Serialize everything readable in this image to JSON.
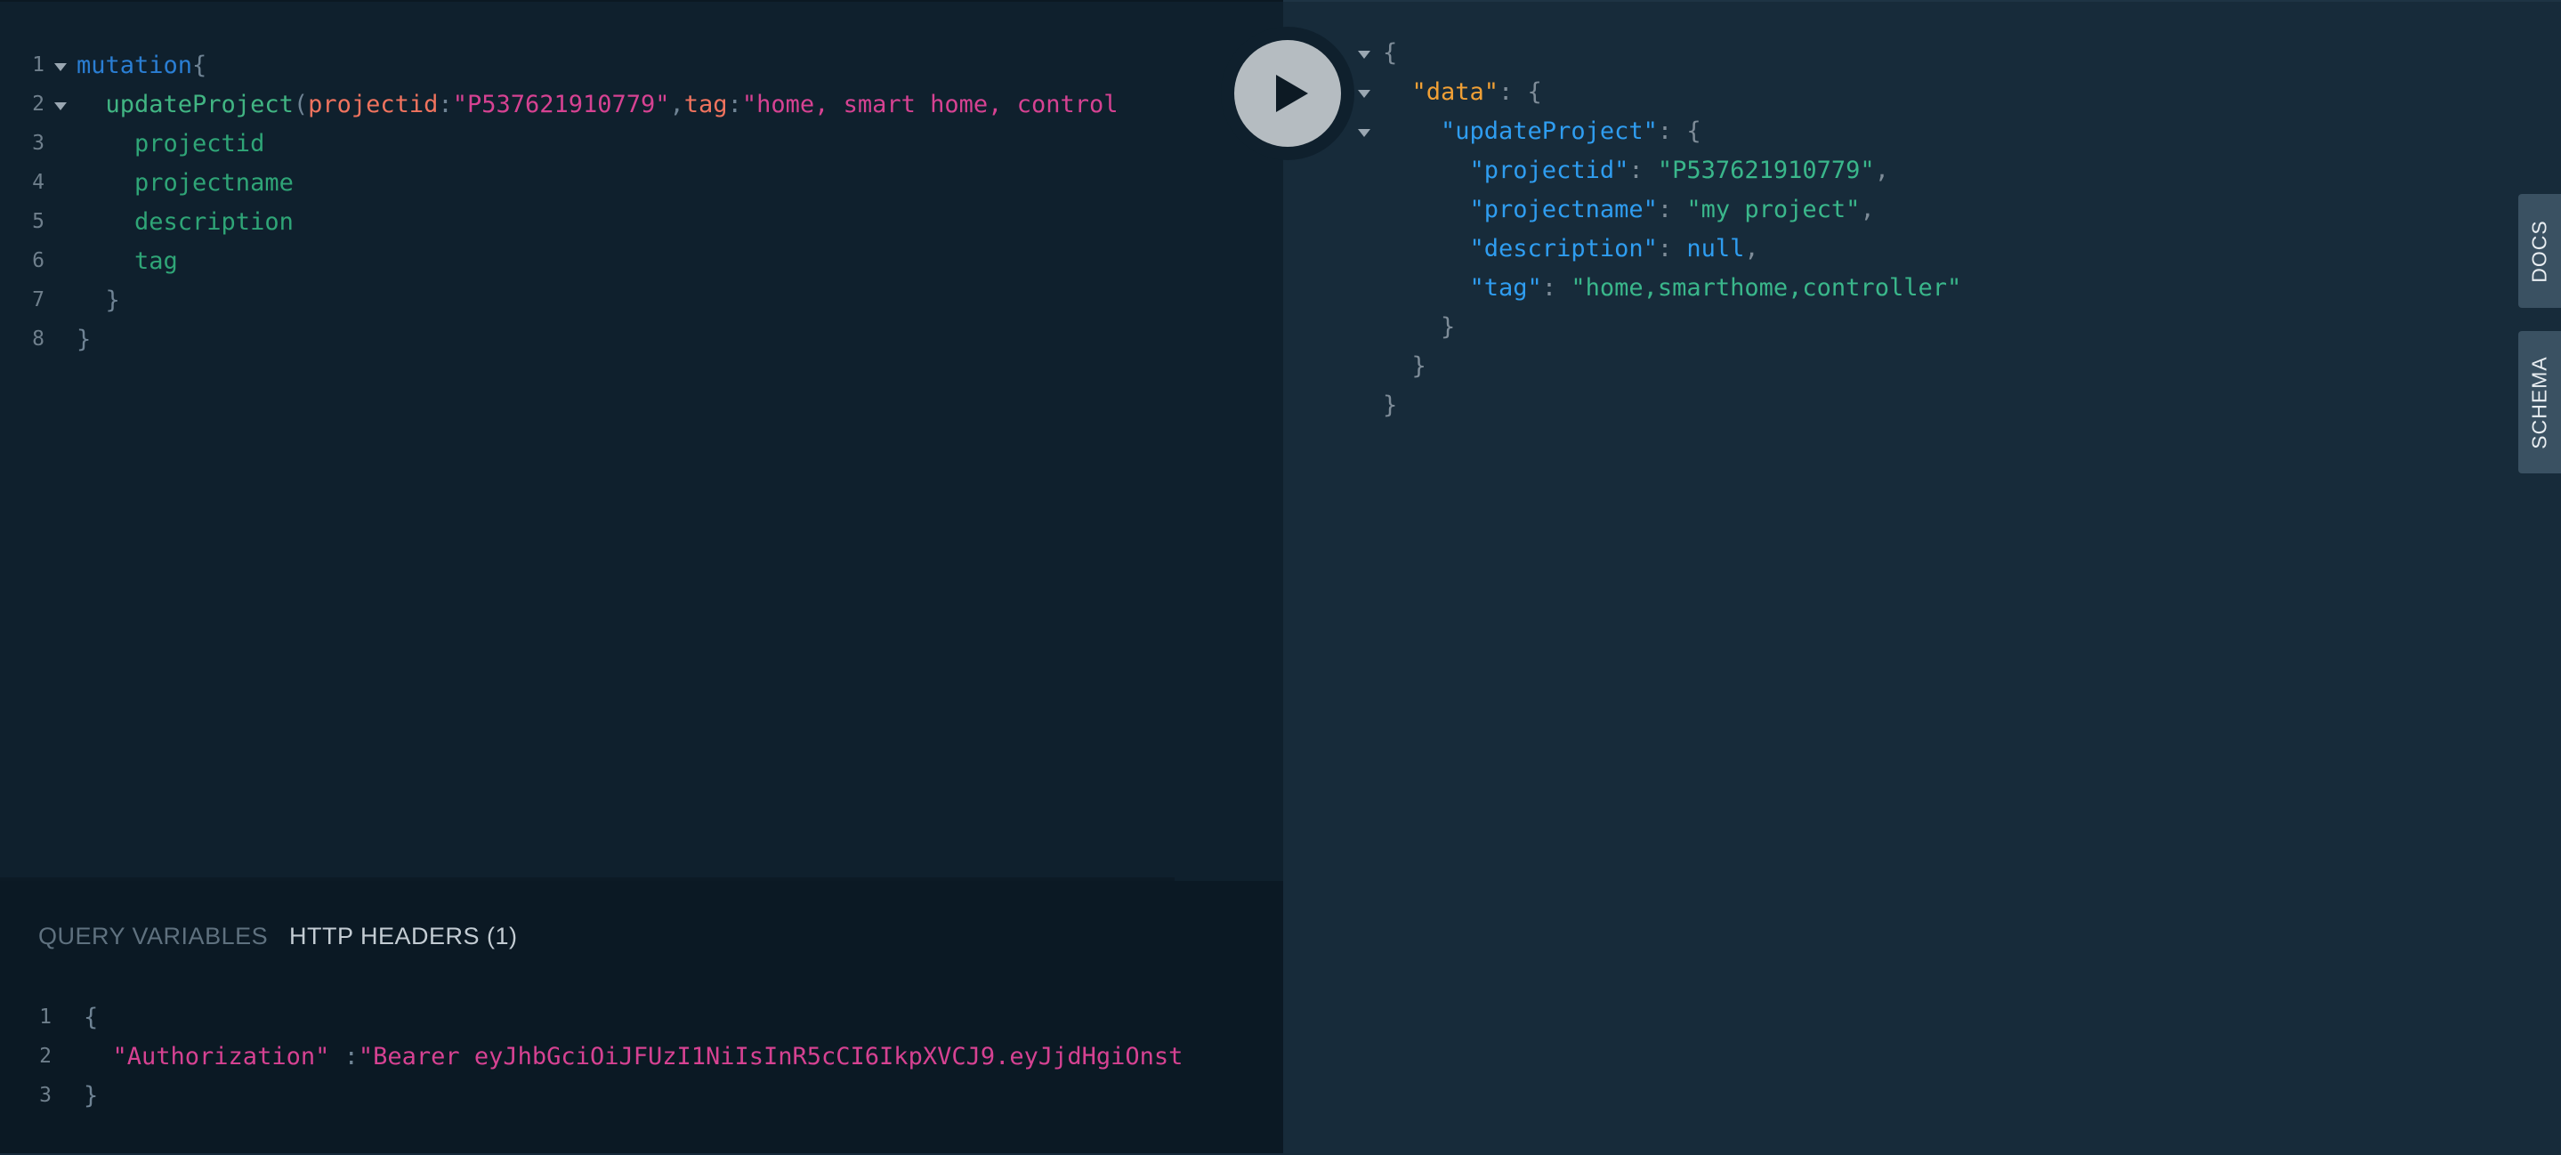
{
  "query_editor": {
    "lines": [
      {
        "num": "1",
        "parts": [
          {
            "t": "mutation",
            "c": "kw"
          },
          {
            "t": "{",
            "c": "punc"
          }
        ]
      },
      {
        "num": "2",
        "parts": [
          {
            "t": "  updateProject",
            "c": "fn"
          },
          {
            "t": "(",
            "c": "punc"
          },
          {
            "t": "projectid",
            "c": "arg"
          },
          {
            "t": ":",
            "c": "punc"
          },
          {
            "t": "\"P537621910779\"",
            "c": "str"
          },
          {
            "t": ",",
            "c": "punc"
          },
          {
            "t": "tag",
            "c": "arg"
          },
          {
            "t": ":",
            "c": "punc"
          },
          {
            "t": "\"home, smart home, control",
            "c": "str"
          }
        ]
      },
      {
        "num": "3",
        "parts": [
          {
            "t": "    projectid",
            "c": "field"
          }
        ]
      },
      {
        "num": "4",
        "parts": [
          {
            "t": "    projectname",
            "c": "field"
          }
        ]
      },
      {
        "num": "5",
        "parts": [
          {
            "t": "    description",
            "c": "field"
          }
        ]
      },
      {
        "num": "6",
        "parts": [
          {
            "t": "    tag",
            "c": "field"
          }
        ]
      },
      {
        "num": "7",
        "parts": [
          {
            "t": "  }",
            "c": "punc"
          }
        ]
      },
      {
        "num": "8",
        "parts": [
          {
            "t": "}",
            "c": "punc"
          }
        ]
      }
    ]
  },
  "result": {
    "lines": [
      {
        "parts": [
          {
            "t": "{",
            "c": "jpunc"
          }
        ]
      },
      {
        "parts": [
          {
            "t": "  \"data\"",
            "c": "jkey-d"
          },
          {
            "t": ": {",
            "c": "jpunc"
          }
        ]
      },
      {
        "parts": [
          {
            "t": "    \"updateProject\"",
            "c": "jkey"
          },
          {
            "t": ": {",
            "c": "jpunc"
          }
        ]
      },
      {
        "parts": [
          {
            "t": "      \"projectid\"",
            "c": "jkey"
          },
          {
            "t": ": ",
            "c": "jpunc"
          },
          {
            "t": "\"P537621910779\"",
            "c": "jstr"
          },
          {
            "t": ",",
            "c": "jpunc"
          }
        ]
      },
      {
        "parts": [
          {
            "t": "      \"projectname\"",
            "c": "jkey"
          },
          {
            "t": ": ",
            "c": "jpunc"
          },
          {
            "t": "\"my project\"",
            "c": "jstr"
          },
          {
            "t": ",",
            "c": "jpunc"
          }
        ]
      },
      {
        "parts": [
          {
            "t": "      \"description\"",
            "c": "jkey"
          },
          {
            "t": ": ",
            "c": "jpunc"
          },
          {
            "t": "null",
            "c": "jnull"
          },
          {
            "t": ",",
            "c": "jpunc"
          }
        ]
      },
      {
        "parts": [
          {
            "t": "      \"tag\"",
            "c": "jkey"
          },
          {
            "t": ": ",
            "c": "jpunc"
          },
          {
            "t": "\"home,smarthome,controller\"",
            "c": "jstr"
          }
        ]
      },
      {
        "parts": [
          {
            "t": "    }",
            "c": "jpunc"
          }
        ]
      },
      {
        "parts": [
          {
            "t": "  }",
            "c": "jpunc"
          }
        ]
      },
      {
        "parts": [
          {
            "t": "}",
            "c": "jpunc"
          }
        ]
      }
    ]
  },
  "side_tabs": {
    "docs": "DOCS",
    "schema": "SCHEMA"
  },
  "bottom_tabs": {
    "query_variables": "QUERY VARIABLES",
    "http_headers": "HTTP HEADERS (1)"
  },
  "headers_editor": {
    "lines": [
      {
        "num": "1",
        "parts": [
          {
            "t": "{",
            "c": "punc"
          }
        ]
      },
      {
        "num": "2",
        "parts": [
          {
            "t": "  \"Authorization\"",
            "c": "str"
          },
          {
            "t": " :",
            "c": "punc"
          },
          {
            "t": "\"Bearer eyJhbGciOiJFUzI1NiIsInR5cCI6IkpXVCJ9.eyJjdHgiOnst",
            "c": "str"
          }
        ]
      },
      {
        "num": "3",
        "parts": [
          {
            "t": "}",
            "c": "punc"
          }
        ]
      }
    ]
  },
  "colors": {
    "background": "#172a3a",
    "query_bg": "#0f202d",
    "accent": "#2a7ed3"
  },
  "icons": {
    "run": "play-icon"
  }
}
